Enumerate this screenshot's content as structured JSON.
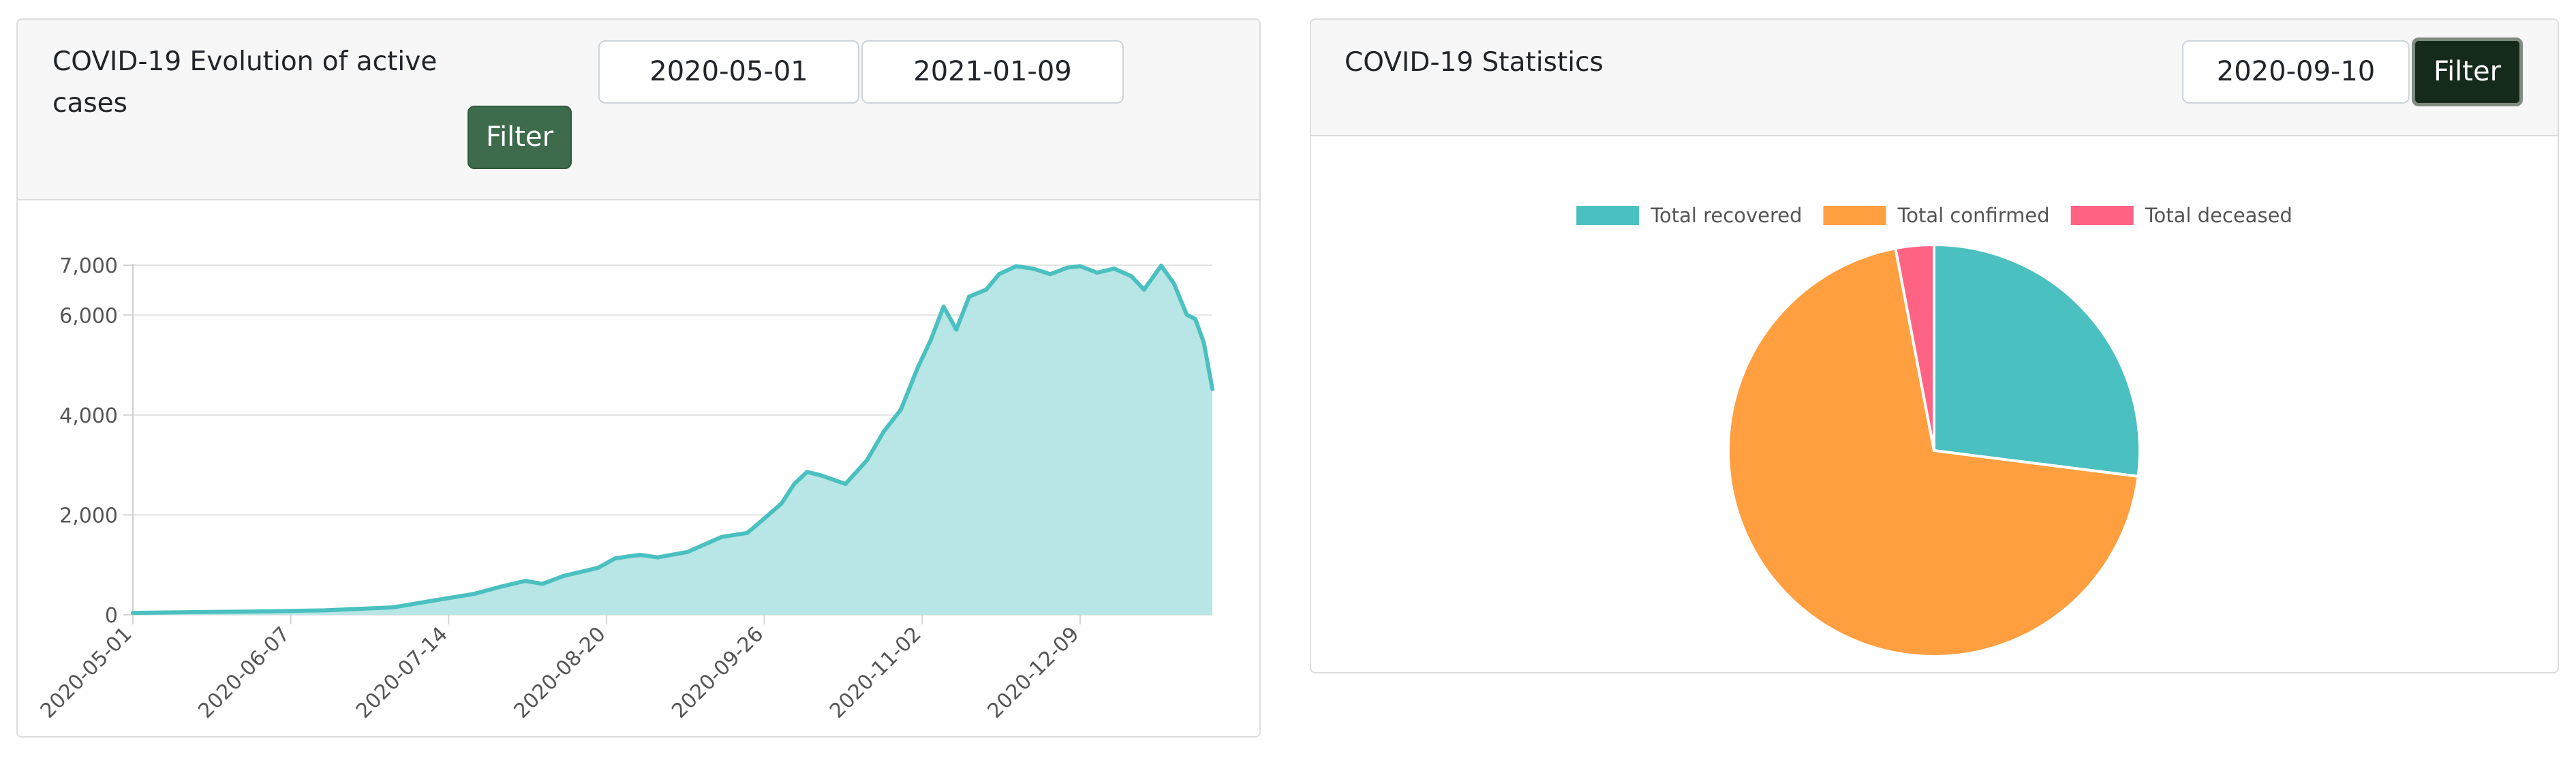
{
  "left_panel": {
    "title_line1": "COVID-19 Evolution of active",
    "title_line2": "cases",
    "start_date": "2020-05-01",
    "end_date": "2021-01-09",
    "filter_label": "Filter"
  },
  "right_panel": {
    "title": "COVID-19 Statistics",
    "date": "2020-09-10",
    "filter_label": "Filter"
  },
  "chart_data": [
    {
      "type": "area",
      "title": "",
      "xlabel": "",
      "ylabel": "",
      "x_tick_labels": [
        "2020-05-01",
        "2020-06-07",
        "2020-07-14",
        "2020-08-20",
        "2020-09-26",
        "2020-11-02",
        "2020-12-09"
      ],
      "y_tick_labels": [
        "0",
        "2,000",
        "4,000",
        "6,000",
        "7,000"
      ],
      "y_ticks": [
        0,
        2000,
        4000,
        6000,
        7000
      ],
      "ylim": [
        0,
        7000
      ],
      "xlim": [
        "2020-05-01",
        "2021-01-09"
      ],
      "grid": true,
      "color": "#4bc0c0",
      "fill_color": "#b8e5e5",
      "series": [
        {
          "x": [
            "2020-05-01",
            "2020-05-15",
            "2020-06-01",
            "2020-06-15",
            "2020-07-01",
            "2020-07-10",
            "2020-07-20",
            "2020-07-26",
            "2020-08-01",
            "2020-08-05",
            "2020-08-10",
            "2020-08-18",
            "2020-08-22",
            "2020-08-26",
            "2020-08-28",
            "2020-09-01",
            "2020-09-08",
            "2020-09-16",
            "2020-09-22",
            "2020-09-26",
            "2020-09-30",
            "2020-10-03",
            "2020-10-06",
            "2020-10-09",
            "2020-10-15",
            "2020-10-20",
            "2020-10-24",
            "2020-10-28",
            "2020-11-01",
            "2020-11-04",
            "2020-11-07",
            "2020-11-10",
            "2020-11-13",
            "2020-11-17",
            "2020-11-20",
            "2020-11-24",
            "2020-11-28",
            "2020-12-02",
            "2020-12-06",
            "2020-12-09",
            "2020-12-13",
            "2020-12-17",
            "2020-12-21",
            "2020-12-24",
            "2020-12-28",
            "2020-12-31",
            "2021-01-03",
            "2021-01-05",
            "2021-01-07",
            "2021-01-09"
          ],
          "values": [
            40,
            55,
            70,
            90,
            150,
            280,
            420,
            560,
            680,
            620,
            780,
            940,
            1130,
            1180,
            1200,
            1150,
            1260,
            1560,
            1640,
            1930,
            2230,
            2620,
            2860,
            2800,
            2620,
            3090,
            3670,
            4110,
            4960,
            5500,
            6170,
            5710,
            6370,
            6510,
            6820,
            6980,
            6930,
            6820,
            6950,
            6980,
            6850,
            6930,
            6780,
            6510,
            6990,
            6630,
            6010,
            5920,
            5450,
            4520
          ]
        }
      ]
    },
    {
      "type": "pie",
      "title": "",
      "legend": [
        "Total recovered",
        "Total confirmed",
        "Total deceased"
      ],
      "legend_position": "top",
      "colors": [
        "#4bc0c0",
        "#ff9f40",
        "#ff6384"
      ],
      "values": [
        27,
        70,
        3
      ]
    }
  ]
}
